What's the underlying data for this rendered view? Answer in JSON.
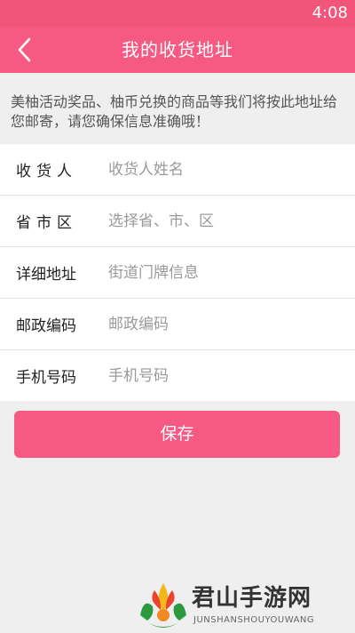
{
  "status_bar": {
    "time": "4:08"
  },
  "header": {
    "title": "我的收货地址"
  },
  "notice": "美柚活动奖品、柚币兑换的商品等我们将按此地址给您邮寄，请您确保信息准确哦！",
  "form": {
    "fields": [
      {
        "label": "收货人",
        "placeholder": "收货人姓名",
        "value": ""
      },
      {
        "label": "省市区",
        "placeholder": "选择省、市、区",
        "value": ""
      },
      {
        "label": "详细地址",
        "placeholder": "街道门牌信息",
        "value": ""
      },
      {
        "label": "邮政编码",
        "placeholder": "邮政编码",
        "value": ""
      },
      {
        "label": "手机号码",
        "placeholder": "手机号码",
        "value": ""
      }
    ]
  },
  "save_label": "保存",
  "watermark": {
    "title": "君山手游网",
    "subtitle": "JUNSHANSHOUYOUWANG"
  },
  "colors": {
    "accent": "#f65a83",
    "status_bar": "#f2557a",
    "background": "#efefef"
  },
  "icons": {
    "back": "chevron-left-icon"
  }
}
